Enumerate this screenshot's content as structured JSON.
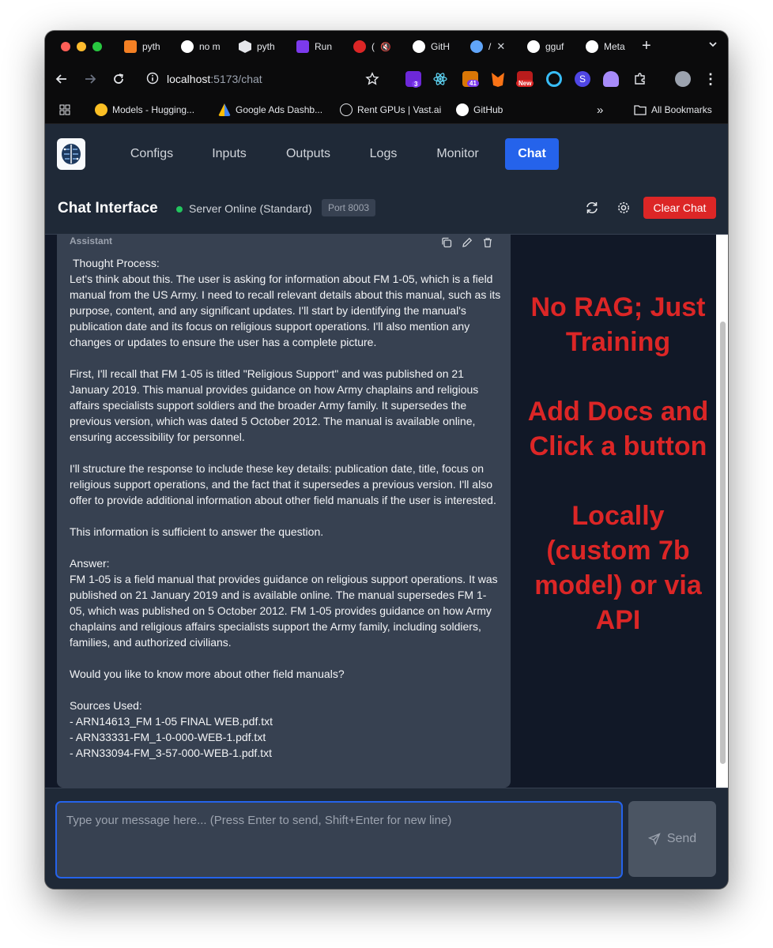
{
  "browser": {
    "tabs": [
      {
        "label": "pyth",
        "icon": "stackoverflow-icon",
        "color": "#f48024"
      },
      {
        "label": "no m",
        "icon": "google-icon",
        "color": "#4285f4"
      },
      {
        "label": "pyth",
        "icon": "hexagon-icon",
        "color": "#e5e7eb"
      },
      {
        "label": "Run",
        "icon": "runpod-icon",
        "color": "#7c3aed"
      },
      {
        "label": "(",
        "icon": "badge-icon",
        "color": "#dc2626"
      },
      {
        "label": "GitH",
        "icon": "github-icon",
        "color": "#ffffff"
      },
      {
        "label": "/",
        "icon": "dna-icon",
        "color": "#60a5fa"
      },
      {
        "label": "gguf",
        "icon": "github-icon",
        "color": "#ffffff"
      },
      {
        "label": "Meta",
        "icon": "github-icon",
        "color": "#ffffff"
      }
    ],
    "url_host": "localhost",
    "url_path": ":5173/chat",
    "extension_badges": [
      "3",
      "41",
      "New"
    ],
    "bookmarks": [
      {
        "label": "Models - Hugging...",
        "icon": "huggingface-icon"
      },
      {
        "label": "Google Ads Dashb...",
        "icon": "google-ads-icon"
      },
      {
        "label": "Rent GPUs | Vast.ai",
        "icon": "vastai-icon"
      },
      {
        "label": "GitHub",
        "icon": "github-icon"
      }
    ],
    "bookmarks_overflow": "»",
    "all_bookmarks": "All Bookmarks"
  },
  "app": {
    "nav": [
      "Configs",
      "Inputs",
      "Outputs",
      "Logs",
      "Monitor",
      "Chat"
    ],
    "active_nav": "Chat",
    "header": {
      "title": "Chat Interface",
      "status": "Server Online (Standard)",
      "port": "Port 8003",
      "clear_label": "Clear Chat"
    },
    "message": {
      "role": "Assistant",
      "paragraphs": [
        [
          "Thought Process:",
          "Let's think about this. The user is asking for information about FM 1-05, which is a field manual from the US Army. I need to recall relevant details about this manual, such as its purpose, content, and any significant updates. I'll start by identifying the manual's publication date and its focus on religious support operations. I'll also mention any changes or updates to ensure the user has a complete picture."
        ],
        [
          "First, I'll recall that FM 1-05 is titled \"Religious Support\" and was published on 21 January 2019. This manual provides guidance on how Army chaplains and religious affairs specialists support soldiers and the broader Army family. It supersedes the previous version, which was dated 5 October 2012. The manual is available online, ensuring accessibility for personnel."
        ],
        [
          "I'll structure the response to include these key details: publication date, title, focus on religious support operations, and the fact that it supersedes a previous version. I'll also offer to provide additional information about other field manuals if the user is interested."
        ],
        [
          "This information is sufficient to answer the question."
        ],
        [
          "Answer:",
          "FM 1-05 is a field manual that provides guidance on religious support operations. It was published on 21 January 2019 and is available online. The manual supersedes FM 1-05, which was published on 5 October 2012. FM 1-05 provides guidance on how Army chaplains and religious affairs specialists support the Army family, including soldiers, families, and authorized civilians."
        ],
        [
          "Would you like to know more about other field manuals?"
        ],
        [
          "Sources Used:",
          "- ARN14613_FM 1-05 FINAL WEB.pdf.txt",
          "- ARN33331-FM_1-0-000-WEB-1.pdf.txt",
          "- ARN33094-FM_3-57-000-WEB-1.pdf.txt"
        ]
      ]
    },
    "overlay": [
      "No RAG; Just Training",
      "Add Docs and Click a button",
      "Locally (custom 7b model) or via API"
    ],
    "input": {
      "placeholder": "Type your message here... (Press Enter to send, Shift+Enter for new line)",
      "send_label": "Send"
    },
    "colors": {
      "accent": "#2563eb",
      "danger": "#dc2626",
      "online": "#22c55e",
      "overlay_text": "#dc2626"
    }
  }
}
